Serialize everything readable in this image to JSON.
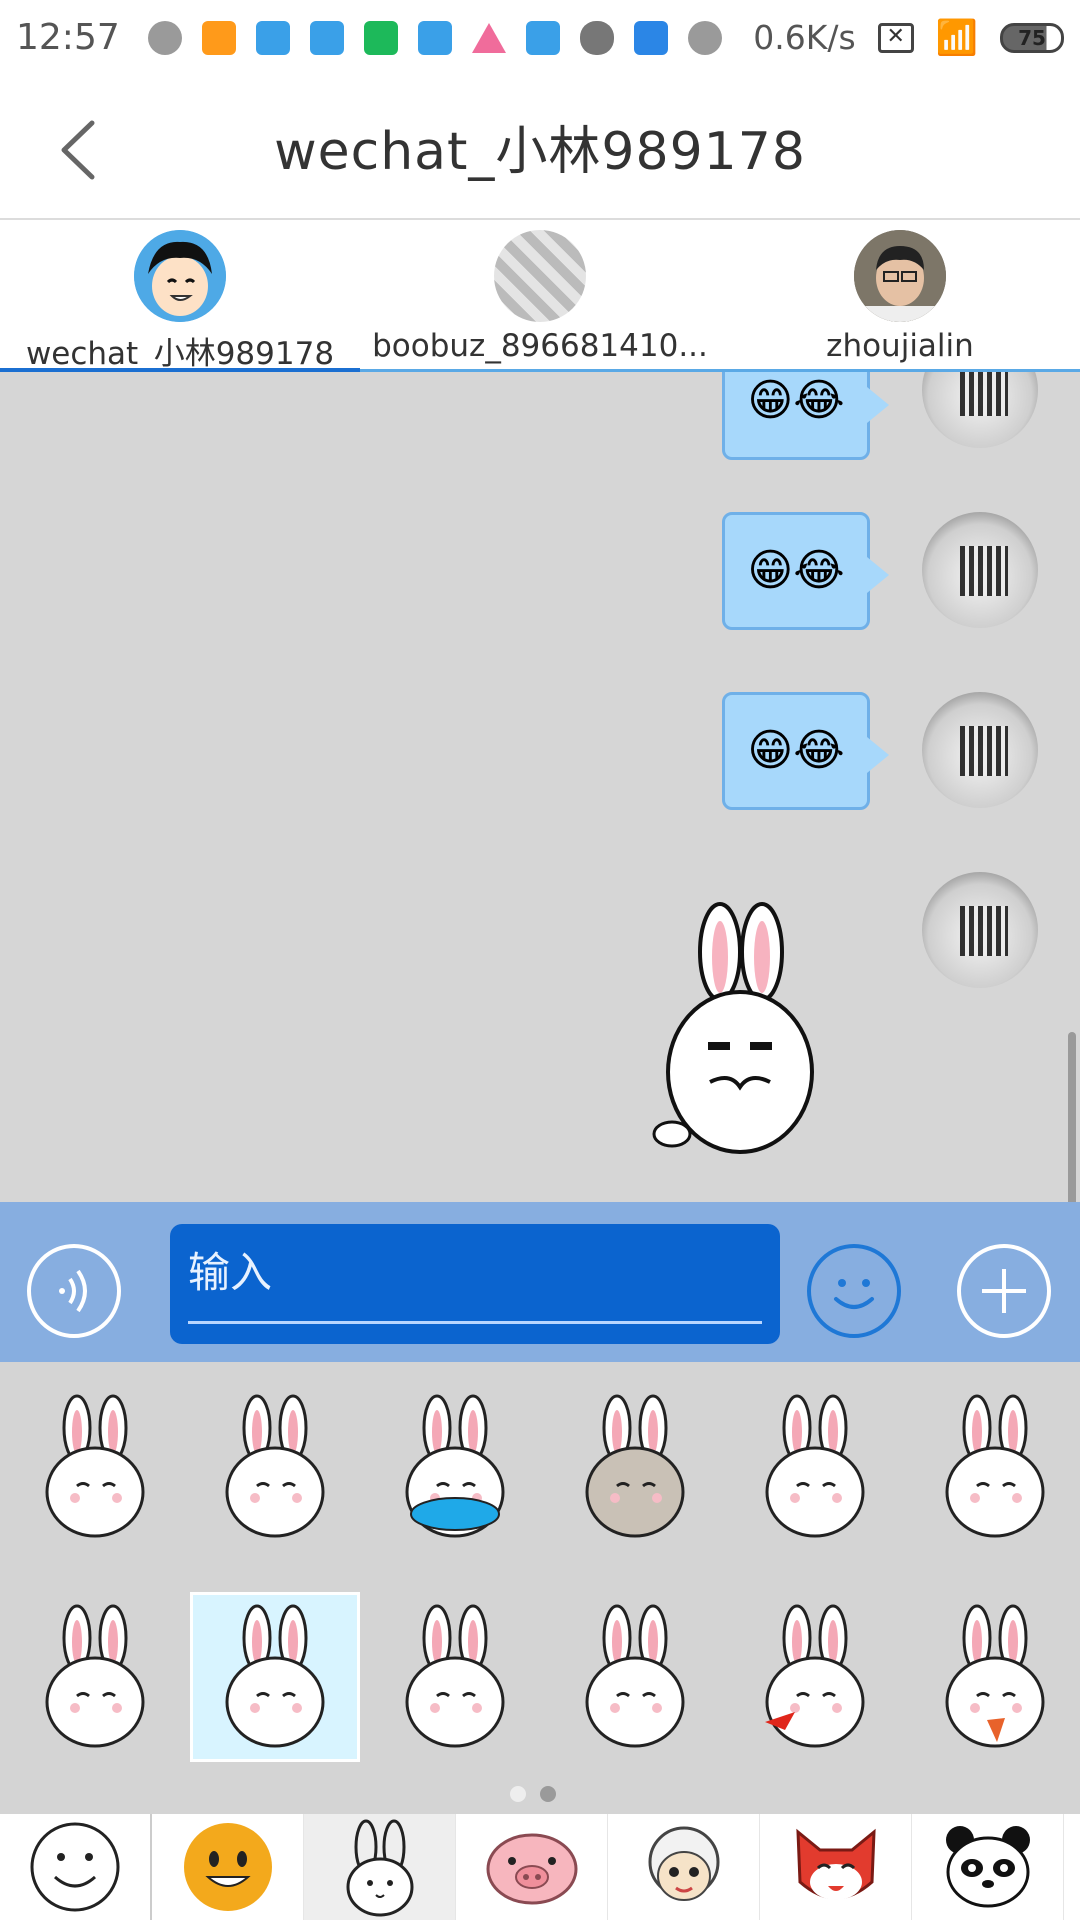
{
  "status_bar": {
    "time": "12:57",
    "net_speed": "0.6K/s",
    "battery": "75"
  },
  "header": {
    "title": "wechat_小林989178"
  },
  "contacts": [
    {
      "name": "wechat_小林989178"
    },
    {
      "name": "boobuz_896681410..."
    },
    {
      "name": "zhoujialin"
    }
  ],
  "messages": [
    {
      "emoji": "😁😂"
    },
    {
      "emoji": "😁😂"
    },
    {
      "emoji": "😁😂"
    }
  ],
  "input": {
    "placeholder": "输入"
  },
  "colors": {
    "chat_bg": "#d6d6d6",
    "bubble": "#a7d8fb",
    "input_bar": "#87aee0",
    "input_field": "#0b64cf",
    "tab_accent": "#1b6fd1"
  },
  "stickers": {
    "selected_index": 7,
    "pages": 2,
    "current_page": 2
  },
  "categories": [
    {
      "icon": "smiley-outline-icon"
    },
    {
      "icon": "smiley-yellow-icon"
    },
    {
      "icon": "rabbit-outline-icon"
    },
    {
      "icon": "pig-icon"
    },
    {
      "icon": "sheep-icon"
    },
    {
      "icon": "fox-icon"
    },
    {
      "icon": "panda-icon"
    }
  ]
}
